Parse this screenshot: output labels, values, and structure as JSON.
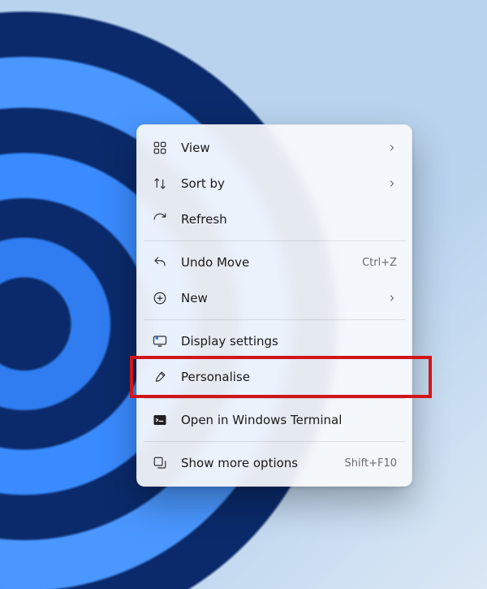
{
  "menu": {
    "items": [
      {
        "id": "view",
        "icon": "grid-icon",
        "label": "View",
        "submenu": true
      },
      {
        "id": "sort-by",
        "icon": "sort-icon",
        "label": "Sort by",
        "submenu": true
      },
      {
        "id": "refresh",
        "icon": "refresh-icon",
        "label": "Refresh"
      },
      {
        "divider": true
      },
      {
        "id": "undo-move",
        "icon": "undo-icon",
        "label": "Undo Move",
        "accelerator": "Ctrl+Z"
      },
      {
        "id": "new",
        "icon": "new-icon",
        "label": "New",
        "submenu": true
      },
      {
        "divider": true
      },
      {
        "id": "display",
        "icon": "display-icon",
        "label": "Display settings"
      },
      {
        "id": "personalise",
        "icon": "paintbrush-icon",
        "label": "Personalise",
        "highlighted": true
      },
      {
        "divider": true
      },
      {
        "id": "terminal",
        "icon": "terminal-icon",
        "label": "Open in Windows Terminal"
      },
      {
        "divider": true
      },
      {
        "id": "more-options",
        "icon": "more-icon",
        "label": "Show more options",
        "accelerator": "Shift+F10"
      }
    ]
  },
  "annotation": {
    "highlight_color": "#d01616"
  }
}
